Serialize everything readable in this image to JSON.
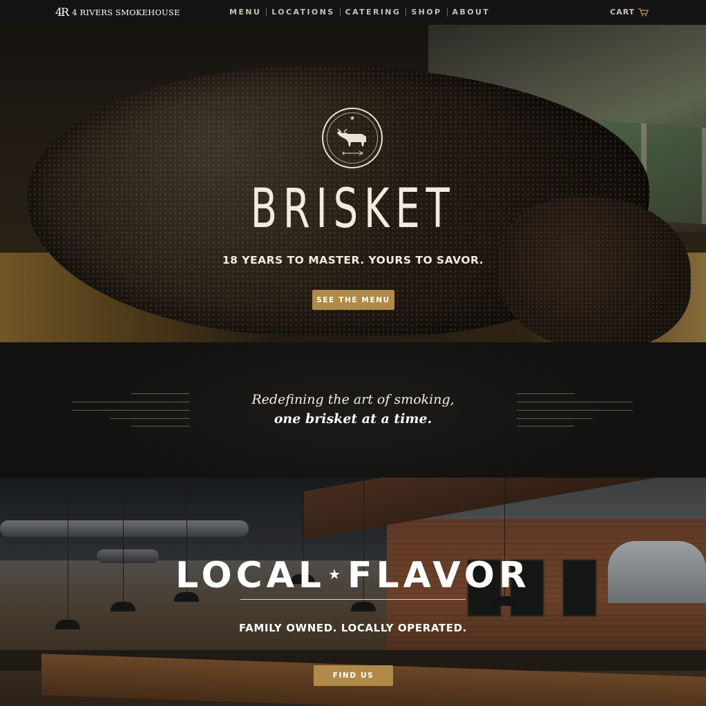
{
  "brand": {
    "logo_mark": "4R",
    "name": "4 RIVERS SMOKEHOUSE"
  },
  "nav": {
    "items": [
      {
        "label": "MENU"
      },
      {
        "label": "LOCATIONS"
      },
      {
        "label": "CATERING"
      },
      {
        "label": "SHOP"
      },
      {
        "label": "ABOUT"
      }
    ],
    "cart_label": "CART"
  },
  "hero": {
    "title": "BRISKET",
    "subtitle": "18 YEARS TO MASTER. YOURS TO SAVOR.",
    "button_label": "SEE THE MENU"
  },
  "tagline": {
    "line1": "Redefining the art of smoking,",
    "line2": "one brisket at a time."
  },
  "local": {
    "title_part1": "LOCAL",
    "star": "★",
    "title_part2": "FLAVOR",
    "subtitle": "FAMILY OWNED. LOCALLY OPERATED.",
    "button_label": "FIND US"
  },
  "colors": {
    "accent_gold": "#b08a48",
    "nav_bg": "#141414",
    "nav_text": "#c9c2b4"
  }
}
